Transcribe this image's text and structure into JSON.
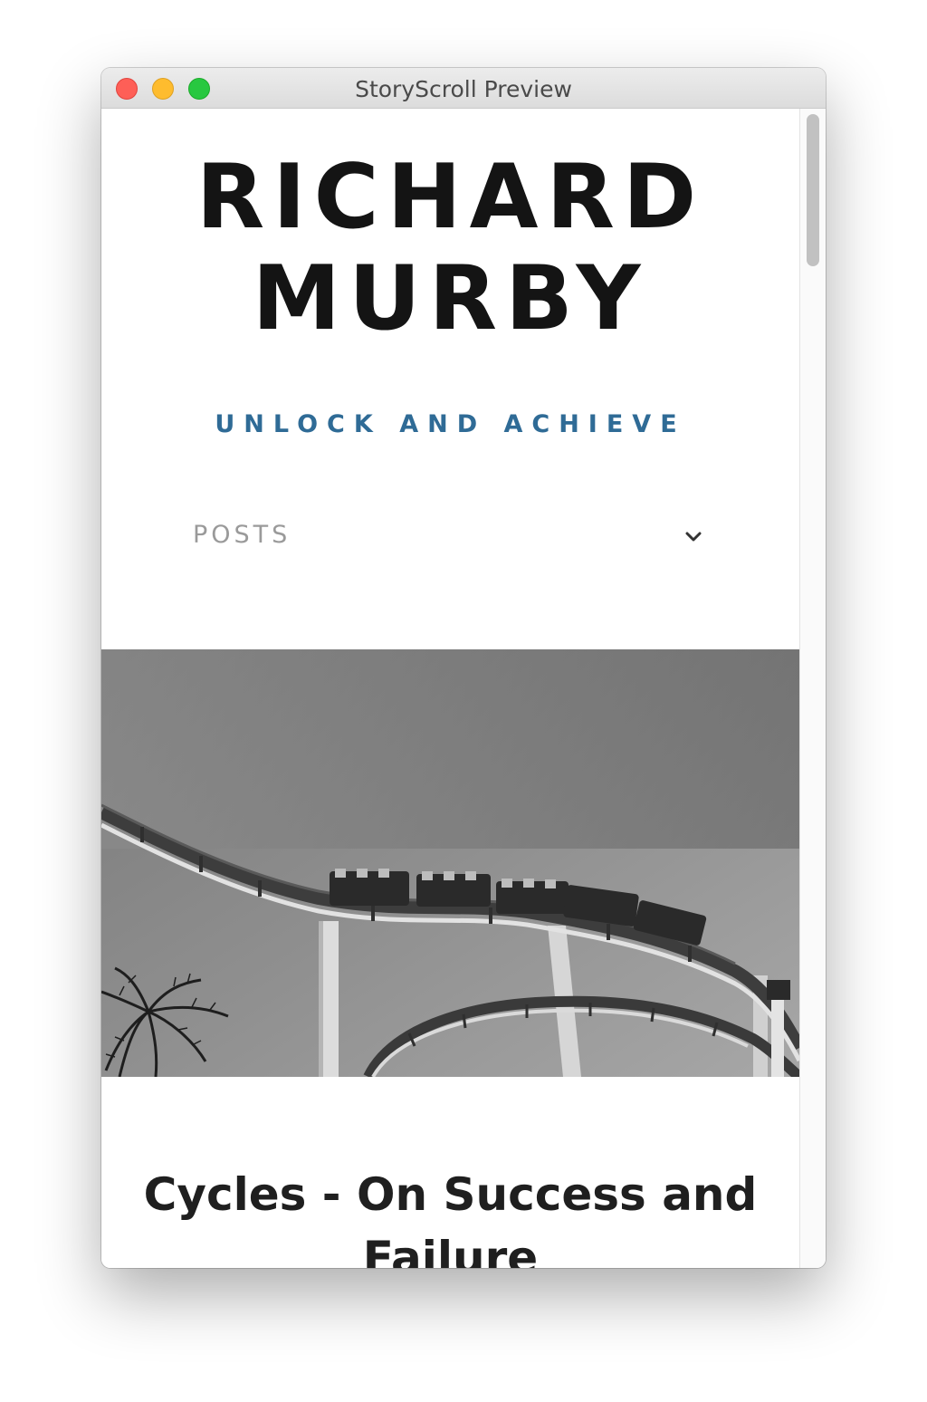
{
  "window": {
    "title": "StoryScroll Preview"
  },
  "site": {
    "title_line1": "RICHARD",
    "title_line2": "MURBY",
    "tagline": "UNLOCK AND ACHIEVE"
  },
  "nav": {
    "label": "POSTS",
    "icon": "chevron-down-icon"
  },
  "hero": {
    "image": "roller-coaster-photo",
    "palette": "grayscale"
  },
  "post": {
    "title": "Cycles - On Success and Failure"
  },
  "colors": {
    "title_text": "#141414",
    "tagline": "#2f6b96",
    "nav_label": "#9a9a9a",
    "post_title": "#1f1f1f",
    "close": "#fe5f57",
    "minimize": "#febc2e",
    "zoom": "#28c840"
  }
}
